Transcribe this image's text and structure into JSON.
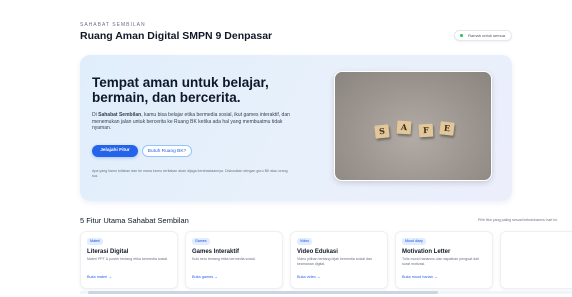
{
  "header": {
    "brand_tag": "SAHABAT SEMBILAN",
    "title": "Ruang Aman Digital SMPN 9 Denpasar",
    "badge": "Ramah untuk semua"
  },
  "hero": {
    "title": "Tempat aman untuk belajar, bermain, dan bercerita.",
    "brand_name": "Sahabat Sembilan",
    "desc_prefix": "Di ",
    "desc_rest": ", kamu bisa belajar etika bermedia sosial, ikut games interaktif, dan menemukan jalan untuk bercerita ke Ruang BK ketika ada hal yang membuatmu tidak nyaman.",
    "primary_button": "Jelajahi Fitur",
    "secondary_button": "Butuh Ruang BK?",
    "note": "Apa yang kamu tuliskan dan ke mana kamu ceritakan akan dijaga kerahasiaannya. Diskusikan dengan guru BK atau orang tua.",
    "image_letters": [
      "S",
      "A",
      "F",
      "E"
    ]
  },
  "features": {
    "title": "5 Fitur Utama Sahabat Sembilan",
    "note": "Pilih fitur yang paling sesuai kebutuhanmu hari ini.",
    "cards": [
      {
        "tag": "Materi",
        "title": "Literasi Digital",
        "desc": "Materi PPT & poster tentang etika bermedia sosial.",
        "link": "Buka materi →"
      },
      {
        "tag": "Games",
        "title": "Games Interaktif",
        "desc": "Kuis seru tentang etika bermedia sosial.",
        "link": "Buka games →"
      },
      {
        "tag": "Video",
        "title": "Video Edukasi",
        "desc": "Video pilihan tentang bijak bermedia sosial dan keamanan digital.",
        "link": "Buka video →"
      },
      {
        "tag": "Mood diary",
        "title": "Motivation Letter",
        "desc": "Tulis mood harianmu dan dapatkan penguat dari surat motivasi.",
        "link": "Buka mood harian →"
      }
    ]
  }
}
